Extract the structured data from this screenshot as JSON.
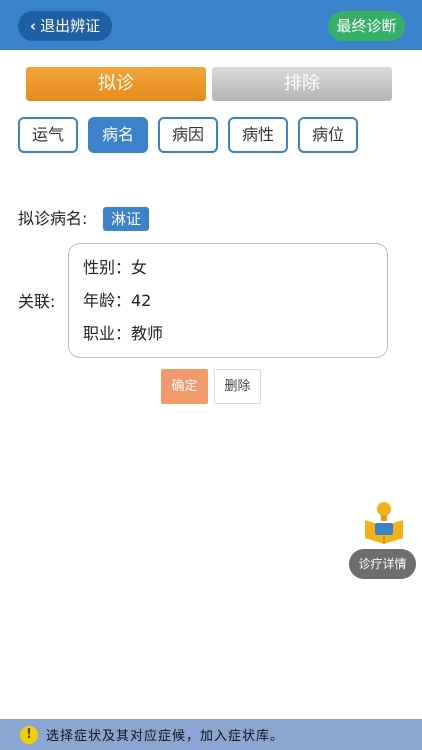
{
  "header": {
    "back_label": "退出辨证",
    "final_label": "最终诊断",
    "colors": {
      "header_bg": "#3a83cb",
      "back_bg": "#1f5fa3",
      "final_bg": "#36b067"
    }
  },
  "main_tabs": [
    {
      "label": "拟诊",
      "active": true
    },
    {
      "label": "排除",
      "active": false
    }
  ],
  "sub_tabs": [
    {
      "label": "运气",
      "active": false
    },
    {
      "label": "病名",
      "active": true
    },
    {
      "label": "病因",
      "active": false
    },
    {
      "label": "病性",
      "active": false
    },
    {
      "label": "病位",
      "active": false
    }
  ],
  "form": {
    "diag_label": "拟诊病名:",
    "diag_value": "淋证",
    "assoc_label": "关联:",
    "assoc_lines": [
      "性别：女",
      "年龄：42",
      "职业：教师"
    ],
    "confirm_label": "确定",
    "delete_label": "删除"
  },
  "float": {
    "icon": "reading-person-icon",
    "detail_label": "诊疗详情"
  },
  "bottom": {
    "icon": "warning-icon",
    "icon_glyph": "!",
    "hint": "选择症状及其对应症候，加入症状库。"
  }
}
